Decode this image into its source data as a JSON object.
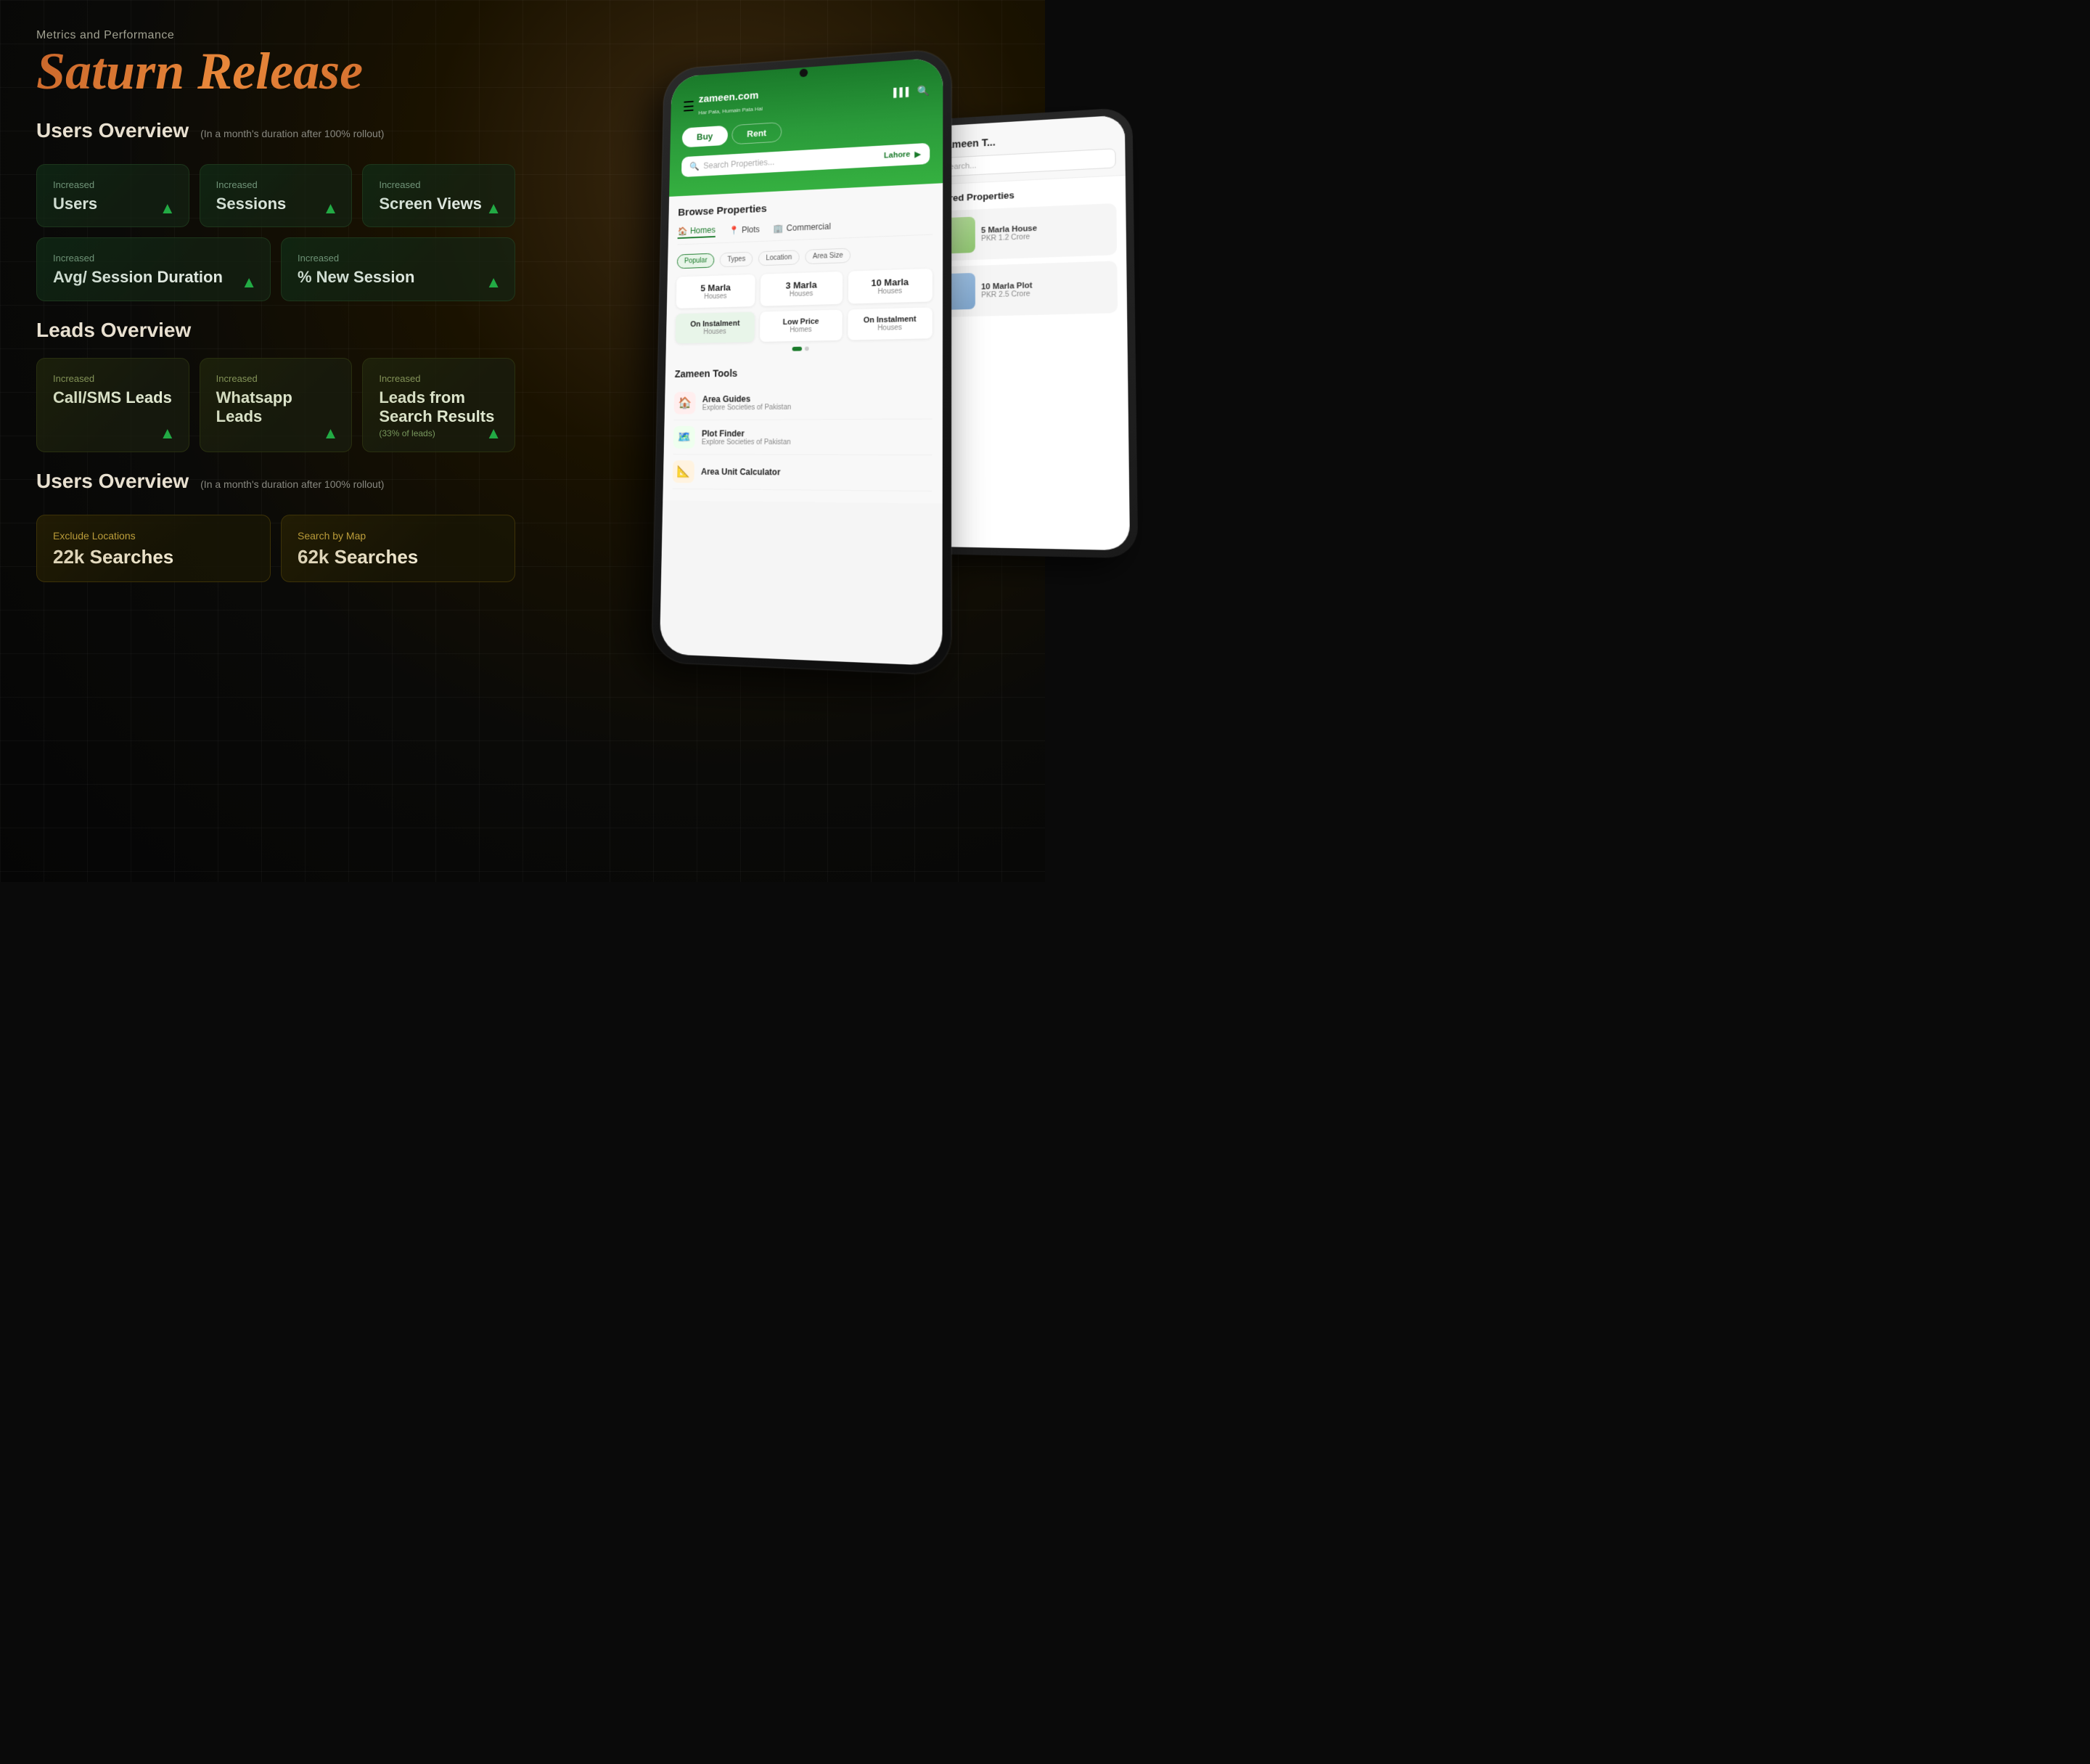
{
  "header": {
    "subtitle": "Metrics and Performance",
    "title": "Saturn Release"
  },
  "users_overview": {
    "section_title": "Users Overview",
    "section_subtitle": "(In a month's duration after 100% rollout)",
    "cards_row1": [
      {
        "label": "Increased",
        "title": "Users"
      },
      {
        "label": "Increased",
        "title": "Sessions"
      },
      {
        "label": "Increased",
        "title": "Screen Views"
      }
    ],
    "cards_row2": [
      {
        "label": "Increased",
        "title": "Avg/ Session Duration"
      },
      {
        "label": "Increased",
        "title": "% New Session"
      }
    ]
  },
  "leads_overview": {
    "section_title": "Leads Overview",
    "cards": [
      {
        "label": "Increased",
        "title": "Call/SMS Leads"
      },
      {
        "label": "Increased",
        "title": "Whatsapp Leads"
      },
      {
        "label": "Increased",
        "title": "Leads from Search Results",
        "subtitle": "(33% of leads)"
      }
    ]
  },
  "search_overview": {
    "section_title": "Users Overview",
    "section_subtitle": "(In a month's duration after 100% rollout)",
    "cards": [
      {
        "label": "Exclude Locations",
        "title": "22k Searches"
      },
      {
        "label": "Search by Map",
        "title": "62k Searches"
      }
    ]
  },
  "phone": {
    "logo_text": "zameen.com",
    "logo_tagline": "Har Pata, Humain Pata Hai",
    "tab_buy": "Buy",
    "tab_rent": "Rent",
    "search_placeholder": "Search Properties...",
    "location": "Lahore",
    "browse_title": "Browse Properties",
    "tabs": [
      "Homes",
      "Plots",
      "Commercial"
    ],
    "filters": [
      "Popular",
      "Types",
      "Location",
      "Area Size"
    ],
    "properties": [
      {
        "size": "5 Marla",
        "type": "Houses"
      },
      {
        "size": "3 Marla",
        "type": "Houses"
      },
      {
        "size": "10 Marla",
        "type": "Houses"
      },
      {
        "size": "On Instalment",
        "type": "Houses"
      },
      {
        "size": "Low Price",
        "type": "Homes"
      },
      {
        "size": "On Instalment",
        "type": "Houses"
      }
    ],
    "tools_title": "Zameen Tools",
    "tools": [
      {
        "name": "Area Guides",
        "sub": "Explore Societies of Pakistan",
        "icon": "🏠"
      },
      {
        "name": "Plot Finder",
        "sub": "Explore Societies of Pakistan",
        "icon": "🗺️"
      },
      {
        "name": "Area Unit Calculator",
        "sub": "",
        "icon": "📐"
      }
    ]
  }
}
